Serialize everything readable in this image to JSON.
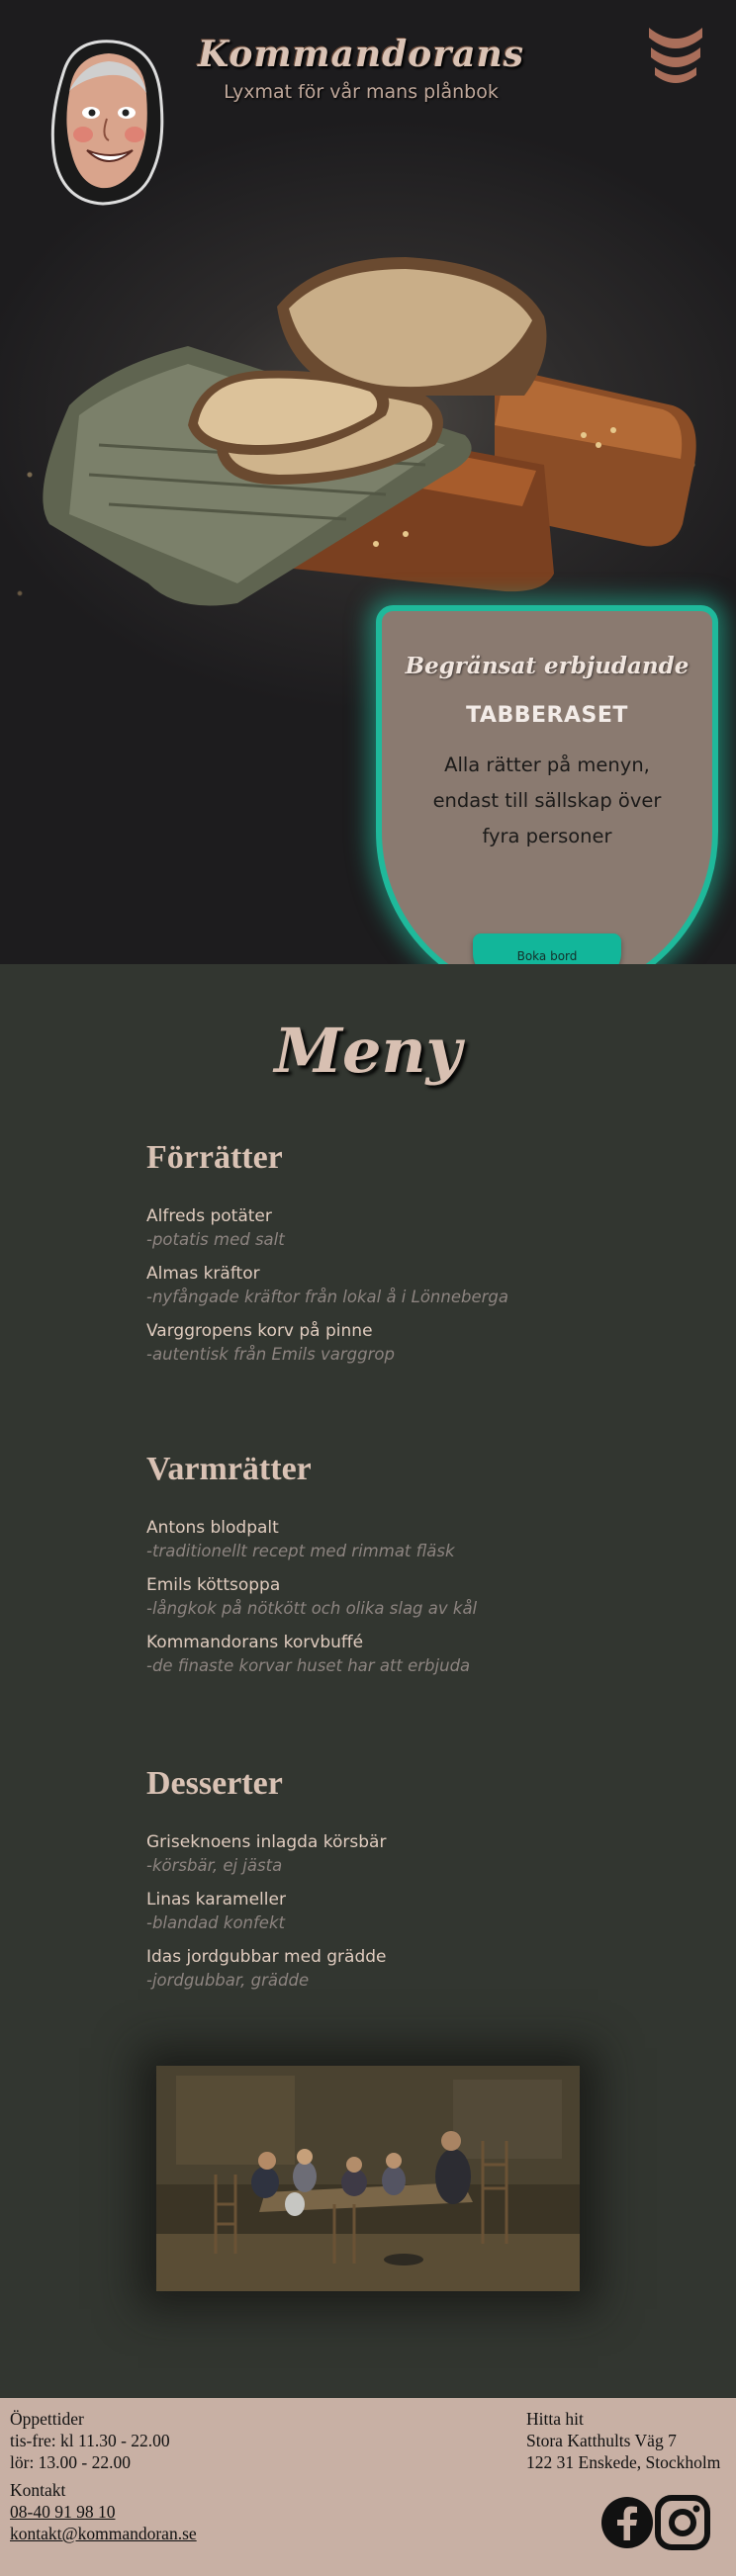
{
  "header": {
    "brand_title": "Kommandorans",
    "brand_subtitle": "Lyxmat för vår mans plånbok"
  },
  "offer": {
    "eyebrow": "Begränsat erbjudande",
    "title": "TABBERASET",
    "text": "Alla rätter på menyn, endast till sällskap över fyra personer",
    "button_label": "Boka bord"
  },
  "menu": {
    "title": "Meny",
    "categories": [
      {
        "title": "Förrätter",
        "dishes": [
          {
            "name": "Alfreds potäter",
            "desc": "-potatis med salt"
          },
          {
            "name": "Almas kräftor",
            "desc": "-nyfångade kräftor från lokal å i Lönneberga"
          },
          {
            "name": "Varggropens korv på pinne",
            "desc": "-autentisk från Emils varggrop"
          }
        ]
      },
      {
        "title": "Varmrätter",
        "dishes": [
          {
            "name": "Antons blodpalt",
            "desc": "-traditionellt recept med rimmat fläsk"
          },
          {
            "name": "Emils köttsoppa",
            "desc": "-långkok på nötkött och olika slag av kål"
          },
          {
            "name": "Kommandorans korvbuffé",
            "desc": "-de finaste korvar huset har att erbjuda"
          }
        ]
      },
      {
        "title": "Desserter",
        "dishes": [
          {
            "name": "Griseknoens inlagda körsbär",
            "desc": "-körsbär, ej jästa"
          },
          {
            "name": "Linas karameller",
            "desc": "-blandad konfekt"
          },
          {
            "name": "Idas jordgubbar med grädde",
            "desc": "-jordgubbar, grädde"
          }
        ]
      }
    ]
  },
  "footer": {
    "hours_heading": "Öppettider",
    "hours_weekday": "tis-fre: kl 11.30 - 22.00",
    "hours_saturday": "lör: 13.00 - 22.00",
    "contact_heading": "Kontakt",
    "phone": "08-40 91 98 10",
    "email": "kontakt@kommandoran.se",
    "find_heading": "Hitta hit",
    "address_line1": "Stora Katthults Väg 7",
    "address_line2": "122 31 Enskede, Stockholm"
  },
  "icons": {
    "menu_toggle": "chevrons-down-icon",
    "facebook": "facebook-icon",
    "instagram": "instagram-icon"
  },
  "colors": {
    "accent": "#1fb99b",
    "offer_bg": "#8a7a70",
    "menu_bg": "#323630",
    "footer_bg": "#c8b0a4",
    "heading": "#d9c2b4"
  }
}
